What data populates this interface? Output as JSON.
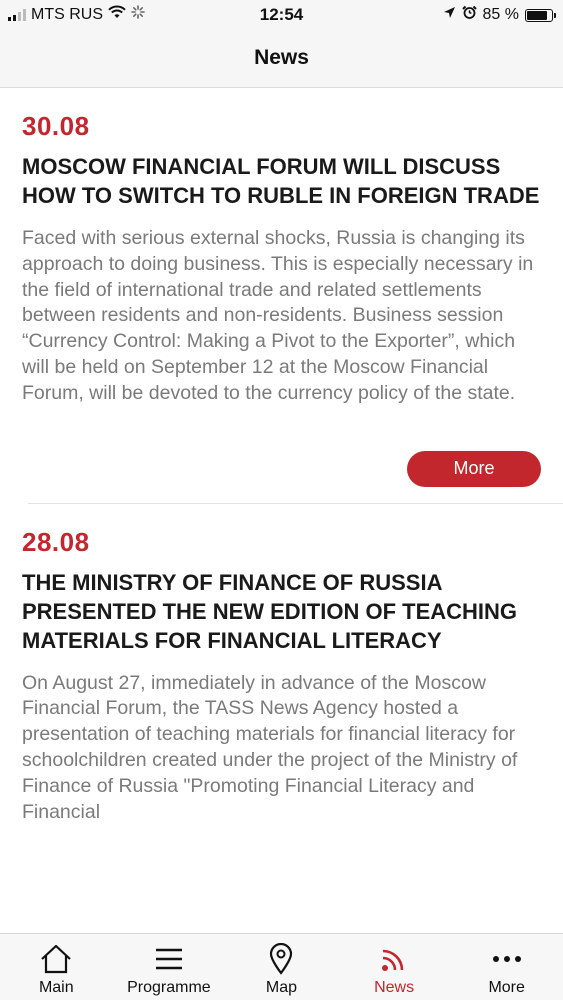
{
  "status_bar": {
    "carrier": "MTS RUS",
    "time": "12:54",
    "battery_percent": "85 %",
    "battery_level": 0.85
  },
  "nav": {
    "title": "News"
  },
  "articles": [
    {
      "date": "30.08",
      "headline": "MOSCOW FINANCIAL FORUM WILL DISCUSS HOW TO SWITCH TO RUBLE IN FOREIGN TRADE",
      "body": "Faced with serious external shocks, Russia is changing its approach to doing business. This is especially necessary in the field of international trade and related settlements between residents and non-residents. Business session “Currency Control: Making a Pivot to the Exporter”, which will be held on September 12 at the Moscow Financial Forum, will be devoted to the currency policy of the state.",
      "more_label": "More"
    },
    {
      "date": "28.08",
      "headline": "THE MINISTRY OF FINANCE OF RUSSIA PRESENTED THE NEW EDITION OF TEACHING MATERIALS FOR FINANCIAL LITERACY",
      "body": "On August 27, immediately in advance of the Moscow Financial Forum, the TASS News Agency hosted a presentation of teaching materials for financial literacy for schoolchildren created under the project of the Ministry of Finance of Russia \"Promoting Financial Literacy and Financial"
    }
  ],
  "tabs": [
    {
      "label": "Main",
      "icon": "home-icon"
    },
    {
      "label": "Programme",
      "icon": "menu-icon"
    },
    {
      "label": "Map",
      "icon": "map-pin-icon"
    },
    {
      "label": "News",
      "icon": "rss-icon",
      "active": true
    },
    {
      "label": "More",
      "icon": "more-icon"
    }
  ],
  "colors": {
    "accent": "#c1272d",
    "body_text": "#7a7a7a",
    "bar_bg": "#f6f6f6"
  }
}
